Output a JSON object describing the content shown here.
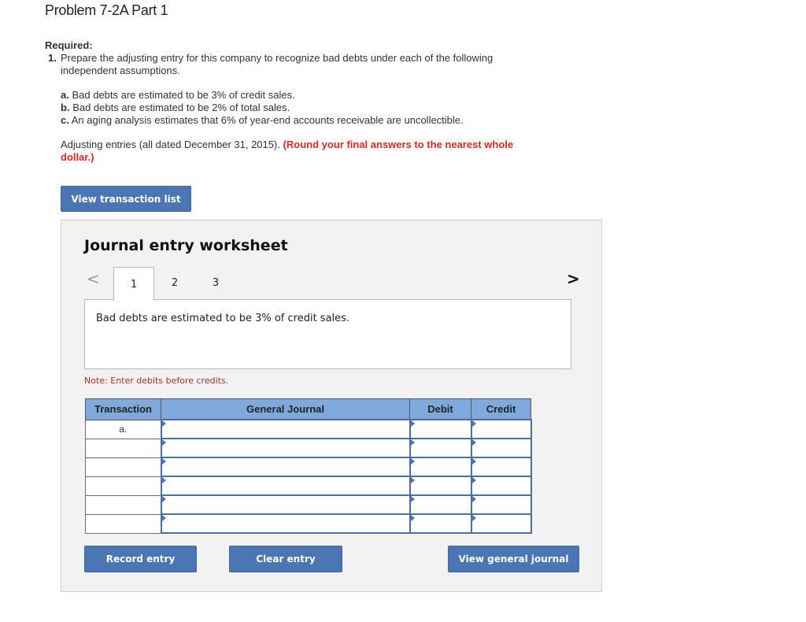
{
  "page": {
    "title": "Problem 7-2A Part 1"
  },
  "required": {
    "label": "Required:",
    "items": [
      {
        "number": "1.",
        "text": "Prepare the adjusting entry for this company to recognize bad debts under each of the following independent assumptions."
      }
    ]
  },
  "assumptions": [
    {
      "letter": "a.",
      "text": "Bad debts are estimated to be 3% of credit sales."
    },
    {
      "letter": "b.",
      "text": "Bad debts are estimated to be 2% of total sales."
    },
    {
      "letter": "c.",
      "text": "An aging analysis estimates that 6% of year-end accounts receivable are uncollectible."
    }
  ],
  "instructions": {
    "text": "Adjusting entries (all dated December 31, 2015).",
    "highlight": "(Round your final answers to the nearest whole dollar.)",
    "highlight_color": "#e0281e"
  },
  "buttons": {
    "view_transaction_list": "View transaction list",
    "record_entry": "Record entry",
    "clear_entry": "Clear entry",
    "view_general_journal": "View general journal",
    "color": "#4a76b3"
  },
  "worksheet": {
    "title": "Journal entry worksheet",
    "nav_prev_icon": "chevron-left-icon",
    "nav_next_icon": "chevron-right-icon",
    "nav_prev_glyph": "<",
    "nav_next_glyph": ">",
    "tabs": [
      {
        "label": "1",
        "active": true
      },
      {
        "label": "2",
        "active": false
      },
      {
        "label": "3",
        "active": false
      }
    ],
    "description": "Bad debts are estimated to be 3% of credit sales.",
    "note": "Note: Enter debits before credits.",
    "table": {
      "headers": [
        "Transaction",
        "General Journal",
        "Debit",
        "Credit"
      ],
      "header_color": "#7fa8dc",
      "rows": [
        {
          "transaction": "a.",
          "general_journal": "",
          "debit": "",
          "credit": ""
        },
        {
          "transaction": "",
          "general_journal": "",
          "debit": "",
          "credit": ""
        },
        {
          "transaction": "",
          "general_journal": "",
          "debit": "",
          "credit": ""
        },
        {
          "transaction": "",
          "general_journal": "",
          "debit": "",
          "credit": ""
        },
        {
          "transaction": "",
          "general_journal": "",
          "debit": "",
          "credit": ""
        },
        {
          "transaction": "",
          "general_journal": "",
          "debit": "",
          "credit": ""
        }
      ]
    }
  }
}
